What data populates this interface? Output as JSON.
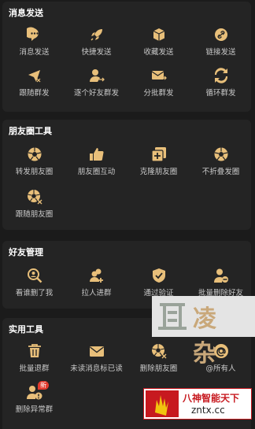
{
  "accent": "#e8bf7a",
  "sections": [
    {
      "title": "消息发送",
      "items": [
        {
          "label": "消息发送",
          "icon": "chat-icon"
        },
        {
          "label": "快捷发送",
          "icon": "rocket-icon"
        },
        {
          "label": "收藏发送",
          "icon": "box-icon"
        },
        {
          "label": "链接发送",
          "icon": "link-icon"
        },
        {
          "label": "跟随群发",
          "icon": "send-follow-icon"
        },
        {
          "label": "逐个好友群发",
          "icon": "user-send-icon"
        },
        {
          "label": "分批群发",
          "icon": "mail-batch-icon"
        },
        {
          "label": "循环群发",
          "icon": "loop-icon"
        }
      ]
    },
    {
      "title": "朋友圈工具",
      "items": [
        {
          "label": "转发朋友圈",
          "icon": "aperture-icon"
        },
        {
          "label": "朋友圈互动",
          "icon": "thumbs-up-icon"
        },
        {
          "label": "克隆朋友圈",
          "icon": "clone-icon"
        },
        {
          "label": "不折叠发圈",
          "icon": "aperture-icon"
        },
        {
          "label": "跟随朋友圈",
          "icon": "aperture-follow-icon"
        }
      ]
    },
    {
      "title": "好友管理",
      "items": [
        {
          "label": "看谁删了我",
          "icon": "search-user-icon"
        },
        {
          "label": "拉人进群",
          "icon": "add-group-icon"
        },
        {
          "label": "通过验证",
          "icon": "shield-check-icon"
        },
        {
          "label": "批量删除好友",
          "icon": "remove-user-icon"
        }
      ]
    },
    {
      "title": "实用工具",
      "items": [
        {
          "label": "批量退群",
          "icon": "trash-icon"
        },
        {
          "label": "未读消息标已读",
          "icon": "envelope-icon"
        },
        {
          "label": "删除朋友圈",
          "icon": "aperture-delete-icon"
        },
        {
          "label": "@所有人",
          "icon": "at-icon"
        },
        {
          "label": "删除异常群",
          "icon": "group-alert-icon",
          "badge": "新"
        }
      ]
    }
  ],
  "watermarks": {
    "top_text": "凌 杂",
    "bottom_line1": "八神智能天下",
    "bottom_line2": "zntx.cc"
  }
}
